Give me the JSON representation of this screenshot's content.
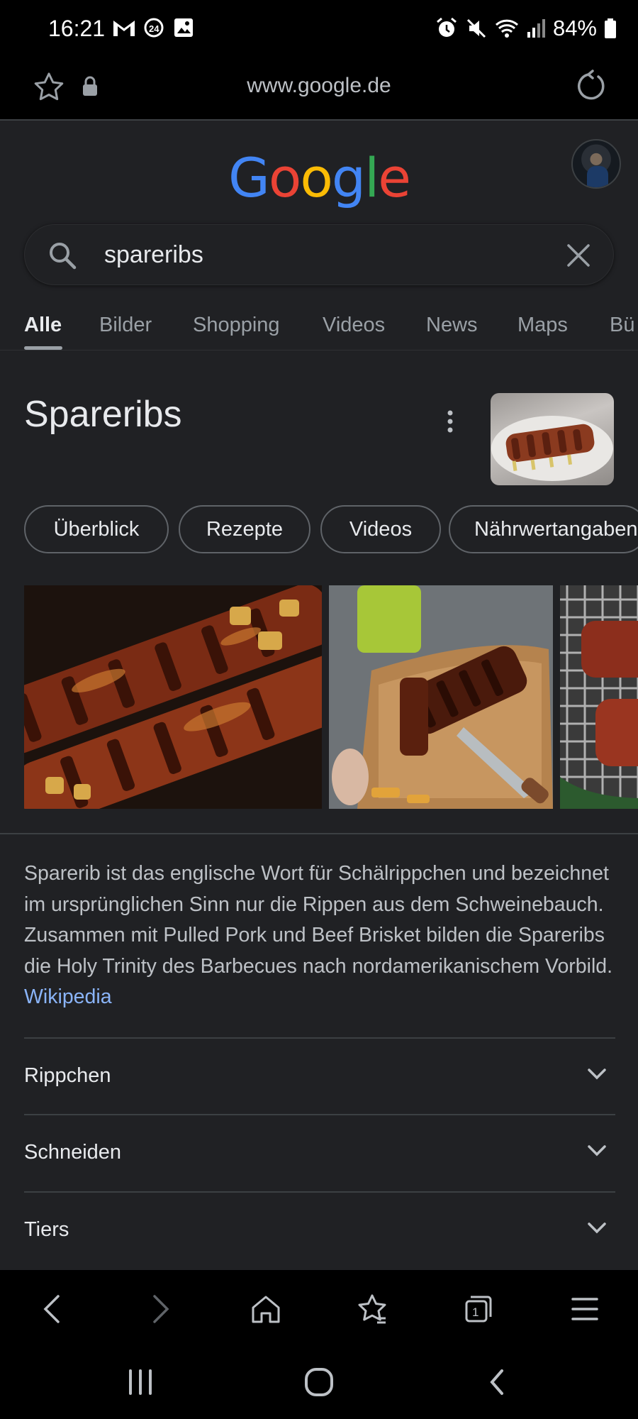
{
  "status_bar": {
    "time": "16:21",
    "battery": "84%",
    "left_icons": [
      "gmail-icon",
      "app-24-icon",
      "gallery-icon"
    ],
    "right_icons": [
      "alarm-icon",
      "mute-icon",
      "wifi-icon",
      "signal-icon",
      "battery-icon"
    ]
  },
  "browser": {
    "url": "www.google.de"
  },
  "search": {
    "query": "spareribs"
  },
  "tabs": [
    {
      "label": "Alle",
      "active": true
    },
    {
      "label": "Bilder"
    },
    {
      "label": "Shopping"
    },
    {
      "label": "Videos"
    },
    {
      "label": "News"
    },
    {
      "label": "Maps"
    },
    {
      "label": "Bü"
    }
  ],
  "knowledge_panel": {
    "title": "Spareribs",
    "chips": [
      "Überblick",
      "Rezepte",
      "Videos",
      "Nährwertangaben"
    ],
    "description": "Sparerib ist das englische Wort für Schälrippchen und bezeichnet im ursprünglichen Sinn nur die Rippen aus dem Schweinebauch. Zusammen mit Pulled Pork und Beef Brisket bilden die Spareribs die Holy Trinity des Barbecues nach nordamerikanischem Vorbild.",
    "source_link": "Wikipedia",
    "accordions": [
      "Rippchen",
      "Schneiden",
      "Tiers"
    ]
  },
  "colors": {
    "page_bg": "#202124",
    "text": "#e8eaed",
    "muted": "#9aa0a6",
    "link": "#8ab4f8",
    "google_blue": "#4285f4",
    "google_red": "#ea4335",
    "google_yellow": "#fbbc05",
    "google_green": "#34a853"
  }
}
